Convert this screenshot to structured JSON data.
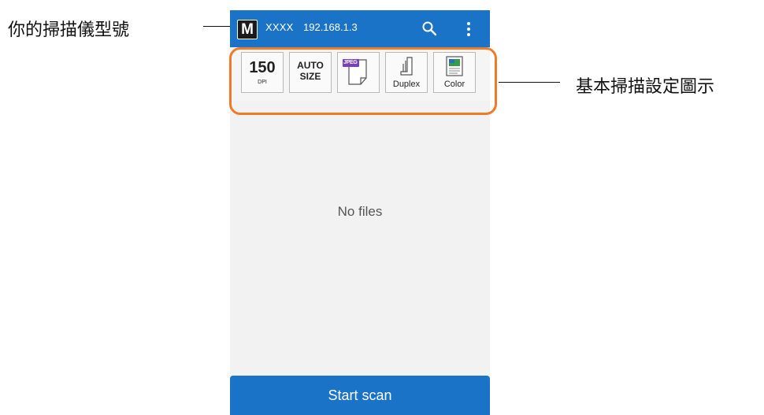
{
  "annotations": {
    "model_label": "你的掃描儀型號",
    "settings_label": "基本掃描設定圖示"
  },
  "appbar": {
    "logo_letter": "M",
    "model": "XXXX",
    "ip": "192.168.1.3",
    "color": "#1a73c7"
  },
  "settings": {
    "resolution": {
      "value": "150",
      "unit": "DPI"
    },
    "paper_size": {
      "line1": "AUTO",
      "line2": "SIZE"
    },
    "file_format": {
      "label": "JPEG"
    },
    "scan_side": {
      "label": "Duplex"
    },
    "color_mode": {
      "label": "Color"
    }
  },
  "content": {
    "empty_message": "No files"
  },
  "actions": {
    "start_scan_label": "Start scan"
  },
  "colors": {
    "highlight": "#ee7a2a",
    "format_badge": "#7a3fc0"
  },
  "icons": [
    "search-icon",
    "more-vert-icon",
    "jpeg-file-icon",
    "duplex-icon",
    "color-image-icon"
  ]
}
